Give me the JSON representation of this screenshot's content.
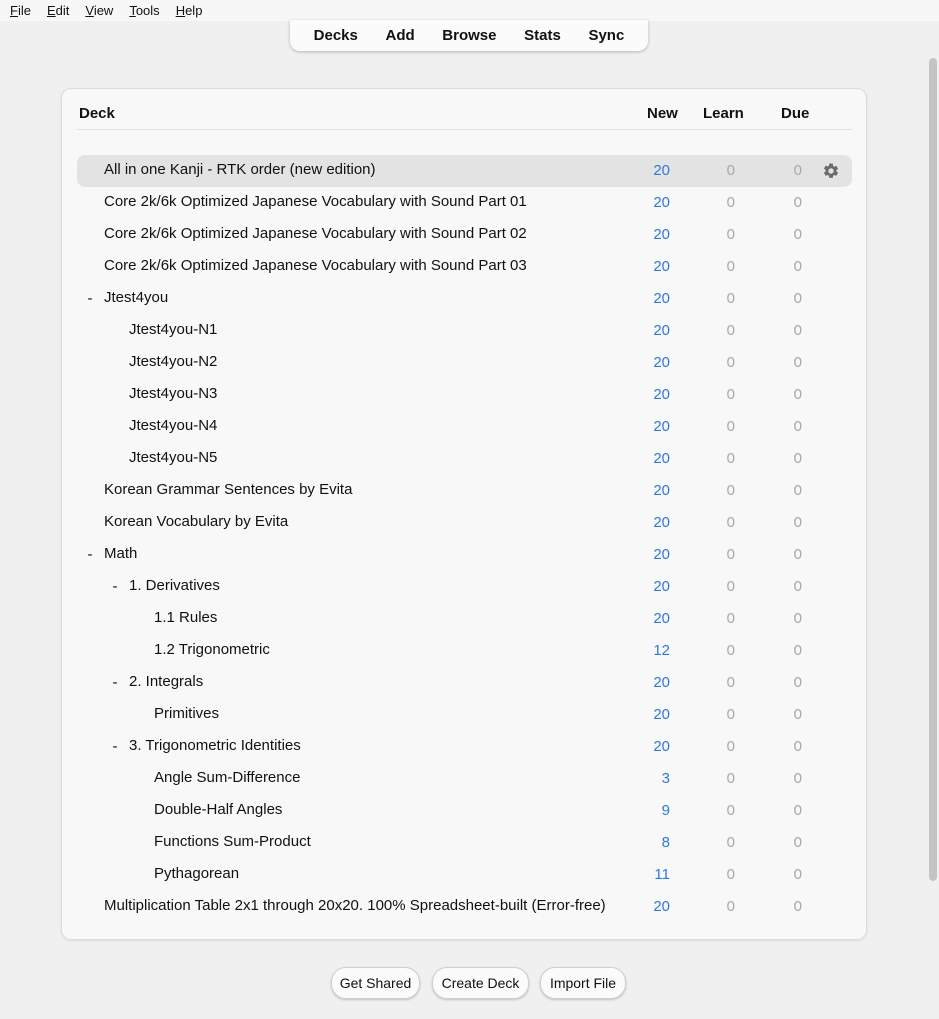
{
  "menu": [
    {
      "key": "F",
      "rest": "ile"
    },
    {
      "key": "E",
      "rest": "dit"
    },
    {
      "key": "V",
      "rest": "iew"
    },
    {
      "key": "T",
      "rest": "ools"
    },
    {
      "key": "H",
      "rest": "elp"
    }
  ],
  "toolbar": {
    "decks": "Decks",
    "add": "Add",
    "browse": "Browse",
    "stats": "Stats",
    "sync": "Sync"
  },
  "header": {
    "deck": "Deck",
    "new": "New",
    "learn": "Learn",
    "due": "Due"
  },
  "colors": {
    "new": "#2e7bd6",
    "zero": "#a8a8a8",
    "current_row": "#e3e3e3"
  },
  "decks": [
    {
      "name": "All in one Kanji - RTK order (new edition)",
      "depth": 0,
      "collapse": "",
      "new": "20",
      "learn": "0",
      "due": "0",
      "current": true
    },
    {
      "name": "Core 2k/6k Optimized Japanese Vocabulary with Sound Part 01",
      "depth": 0,
      "collapse": "",
      "new": "20",
      "learn": "0",
      "due": "0"
    },
    {
      "name": "Core 2k/6k Optimized Japanese Vocabulary with Sound Part 02",
      "depth": 0,
      "collapse": "",
      "new": "20",
      "learn": "0",
      "due": "0"
    },
    {
      "name": "Core 2k/6k Optimized Japanese Vocabulary with Sound Part 03",
      "depth": 0,
      "collapse": "",
      "new": "20",
      "learn": "0",
      "due": "0"
    },
    {
      "name": "Jtest4you",
      "depth": 0,
      "collapse": "-",
      "new": "20",
      "learn": "0",
      "due": "0"
    },
    {
      "name": "Jtest4you-N1",
      "depth": 1,
      "collapse": "",
      "new": "20",
      "learn": "0",
      "due": "0"
    },
    {
      "name": "Jtest4you-N2",
      "depth": 1,
      "collapse": "",
      "new": "20",
      "learn": "0",
      "due": "0"
    },
    {
      "name": "Jtest4you-N3",
      "depth": 1,
      "collapse": "",
      "new": "20",
      "learn": "0",
      "due": "0"
    },
    {
      "name": "Jtest4you-N4",
      "depth": 1,
      "collapse": "",
      "new": "20",
      "learn": "0",
      "due": "0"
    },
    {
      "name": "Jtest4you-N5",
      "depth": 1,
      "collapse": "",
      "new": "20",
      "learn": "0",
      "due": "0"
    },
    {
      "name": "Korean Grammar Sentences by Evita",
      "depth": 0,
      "collapse": "",
      "new": "20",
      "learn": "0",
      "due": "0"
    },
    {
      "name": "Korean Vocabulary by Evita",
      "depth": 0,
      "collapse": "",
      "new": "20",
      "learn": "0",
      "due": "0"
    },
    {
      "name": "Math",
      "depth": 0,
      "collapse": "-",
      "new": "20",
      "learn": "0",
      "due": "0"
    },
    {
      "name": "1. Derivatives",
      "depth": 1,
      "collapse": "-",
      "new": "20",
      "learn": "0",
      "due": "0"
    },
    {
      "name": "1.1 Rules",
      "depth": 2,
      "collapse": "",
      "new": "20",
      "learn": "0",
      "due": "0"
    },
    {
      "name": "1.2 Trigonometric",
      "depth": 2,
      "collapse": "",
      "new": "12",
      "learn": "0",
      "due": "0"
    },
    {
      "name": "2. Integrals",
      "depth": 1,
      "collapse": "-",
      "new": "20",
      "learn": "0",
      "due": "0"
    },
    {
      "name": "Primitives",
      "depth": 2,
      "collapse": "",
      "new": "20",
      "learn": "0",
      "due": "0"
    },
    {
      "name": "3. Trigonometric Identities",
      "depth": 1,
      "collapse": "-",
      "new": "20",
      "learn": "0",
      "due": "0"
    },
    {
      "name": "Angle Sum-Difference",
      "depth": 2,
      "collapse": "",
      "new": "3",
      "learn": "0",
      "due": "0"
    },
    {
      "name": "Double-Half Angles",
      "depth": 2,
      "collapse": "",
      "new": "9",
      "learn": "0",
      "due": "0"
    },
    {
      "name": "Functions Sum-Product",
      "depth": 2,
      "collapse": "",
      "new": "8",
      "learn": "0",
      "due": "0"
    },
    {
      "name": "Pythagorean",
      "depth": 2,
      "collapse": "",
      "new": "11",
      "learn": "0",
      "due": "0"
    },
    {
      "name": "Multiplication Table 2x1 through 20x20. 100% Spreadsheet-built (Error-free)",
      "depth": 0,
      "collapse": "",
      "new": "20",
      "learn": "0",
      "due": "0"
    }
  ],
  "bottom": {
    "get_shared": "Get Shared",
    "create_deck": "Create Deck",
    "import_file": "Import File"
  }
}
